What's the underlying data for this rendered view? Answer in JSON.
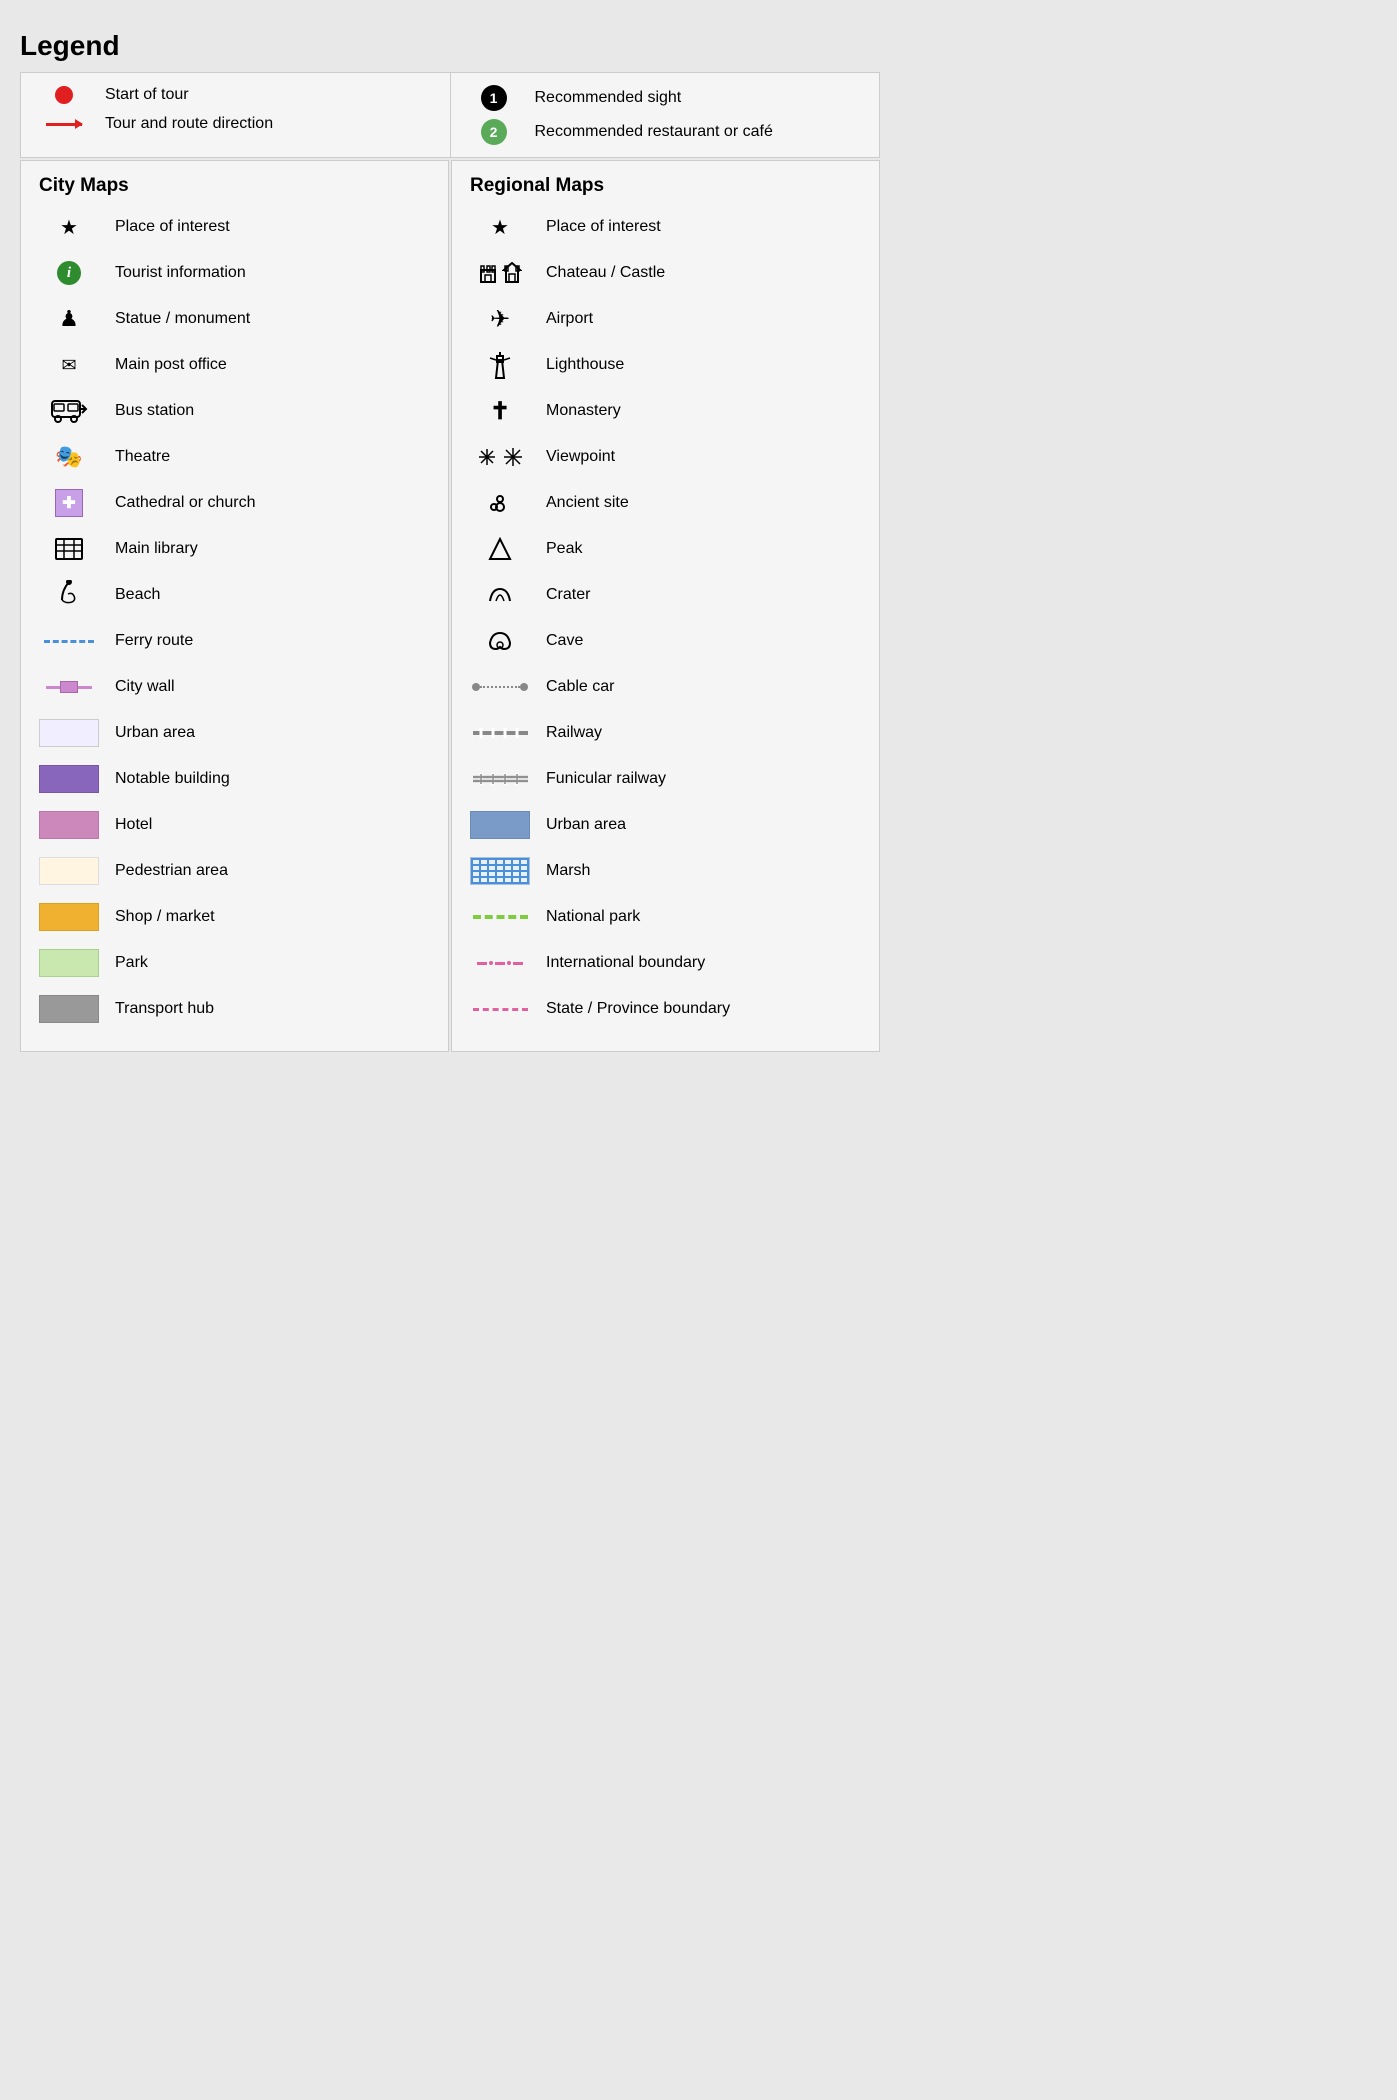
{
  "title": "Legend",
  "top_section": {
    "left": [
      {
        "icon": "red-circle",
        "label": "Start of tour"
      },
      {
        "icon": "red-arrow",
        "label": "Tour and route direction"
      }
    ],
    "right": [
      {
        "icon": "num-1-black",
        "label": "Recommended sight"
      },
      {
        "icon": "num-2-green",
        "label": "Recommended restaurant or café"
      }
    ]
  },
  "city_maps": {
    "title": "City Maps",
    "items": [
      {
        "icon": "star",
        "label": "Place of interest"
      },
      {
        "icon": "info-green",
        "label": "Tourist information"
      },
      {
        "icon": "chess",
        "label": "Statue / monument"
      },
      {
        "icon": "envelope",
        "label": "Main post office"
      },
      {
        "icon": "bus",
        "label": "Bus station"
      },
      {
        "icon": "theatre",
        "label": "Theatre"
      },
      {
        "icon": "cathedral",
        "label": "Cathedral or church"
      },
      {
        "icon": "library",
        "label": "Main library"
      },
      {
        "icon": "bird",
        "label": "Beach"
      },
      {
        "icon": "ferry",
        "label": "Ferry route"
      },
      {
        "icon": "citywall",
        "label": "City wall"
      },
      {
        "icon": "urban-city",
        "label": "Urban area"
      },
      {
        "icon": "notable",
        "label": "Notable building"
      },
      {
        "icon": "hotel",
        "label": "Hotel"
      },
      {
        "icon": "pedestrian",
        "label": "Pedestrian area"
      },
      {
        "icon": "shop",
        "label": "Shop / market"
      },
      {
        "icon": "park",
        "label": "Park"
      },
      {
        "icon": "transport",
        "label": "Transport hub"
      }
    ]
  },
  "regional_maps": {
    "title": "Regional Maps",
    "items": [
      {
        "icon": "star-reg",
        "label": "Place of interest"
      },
      {
        "icon": "castle",
        "label": "Chateau / Castle"
      },
      {
        "icon": "airport",
        "label": "Airport"
      },
      {
        "icon": "lighthouse",
        "label": "Lighthouse"
      },
      {
        "icon": "monastery",
        "label": "Monastery"
      },
      {
        "icon": "viewpoint",
        "label": "Viewpoint"
      },
      {
        "icon": "ancient",
        "label": "Ancient site"
      },
      {
        "icon": "peak",
        "label": "Peak"
      },
      {
        "icon": "crater",
        "label": "Crater"
      },
      {
        "icon": "cave",
        "label": "Cave"
      },
      {
        "icon": "cablecar",
        "label": "Cable car"
      },
      {
        "icon": "railway",
        "label": "Railway"
      },
      {
        "icon": "funicular",
        "label": "Funicular railway"
      },
      {
        "icon": "urban-reg",
        "label": "Urban area"
      },
      {
        "icon": "marsh",
        "label": "Marsh"
      },
      {
        "icon": "natpark",
        "label": "National park"
      },
      {
        "icon": "intlboundary",
        "label": "International boundary"
      },
      {
        "icon": "stateboundary",
        "label": "State / Province boundary"
      }
    ]
  }
}
